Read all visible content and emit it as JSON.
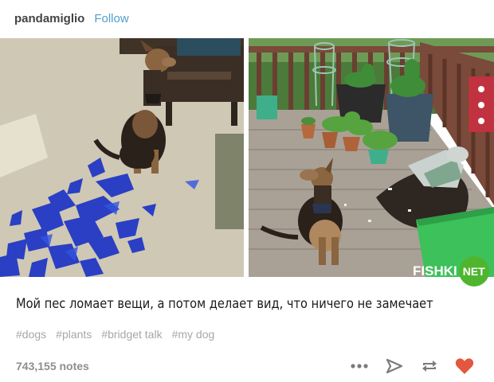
{
  "post": {
    "username": "pandamiglio",
    "follow_label": "Follow",
    "caption": "Мой пес ломает вещи, а потом делает вид, что ничего не замечает",
    "tags": [
      "#dogs",
      "#plants",
      "#bridget talk",
      "#my dog"
    ],
    "notes": "743,155 notes"
  },
  "watermark": {
    "text": "FISHKI",
    "badge": "NET"
  },
  "icons": {
    "more": "more-icon",
    "share": "share-icon",
    "reblog": "reblog-icon",
    "like": "heart-icon"
  },
  "colors": {
    "follow": "#529ecc",
    "like": "#e2573d",
    "watermark_badge": "#4fb52e",
    "text_muted": "#a7a7a7"
  }
}
